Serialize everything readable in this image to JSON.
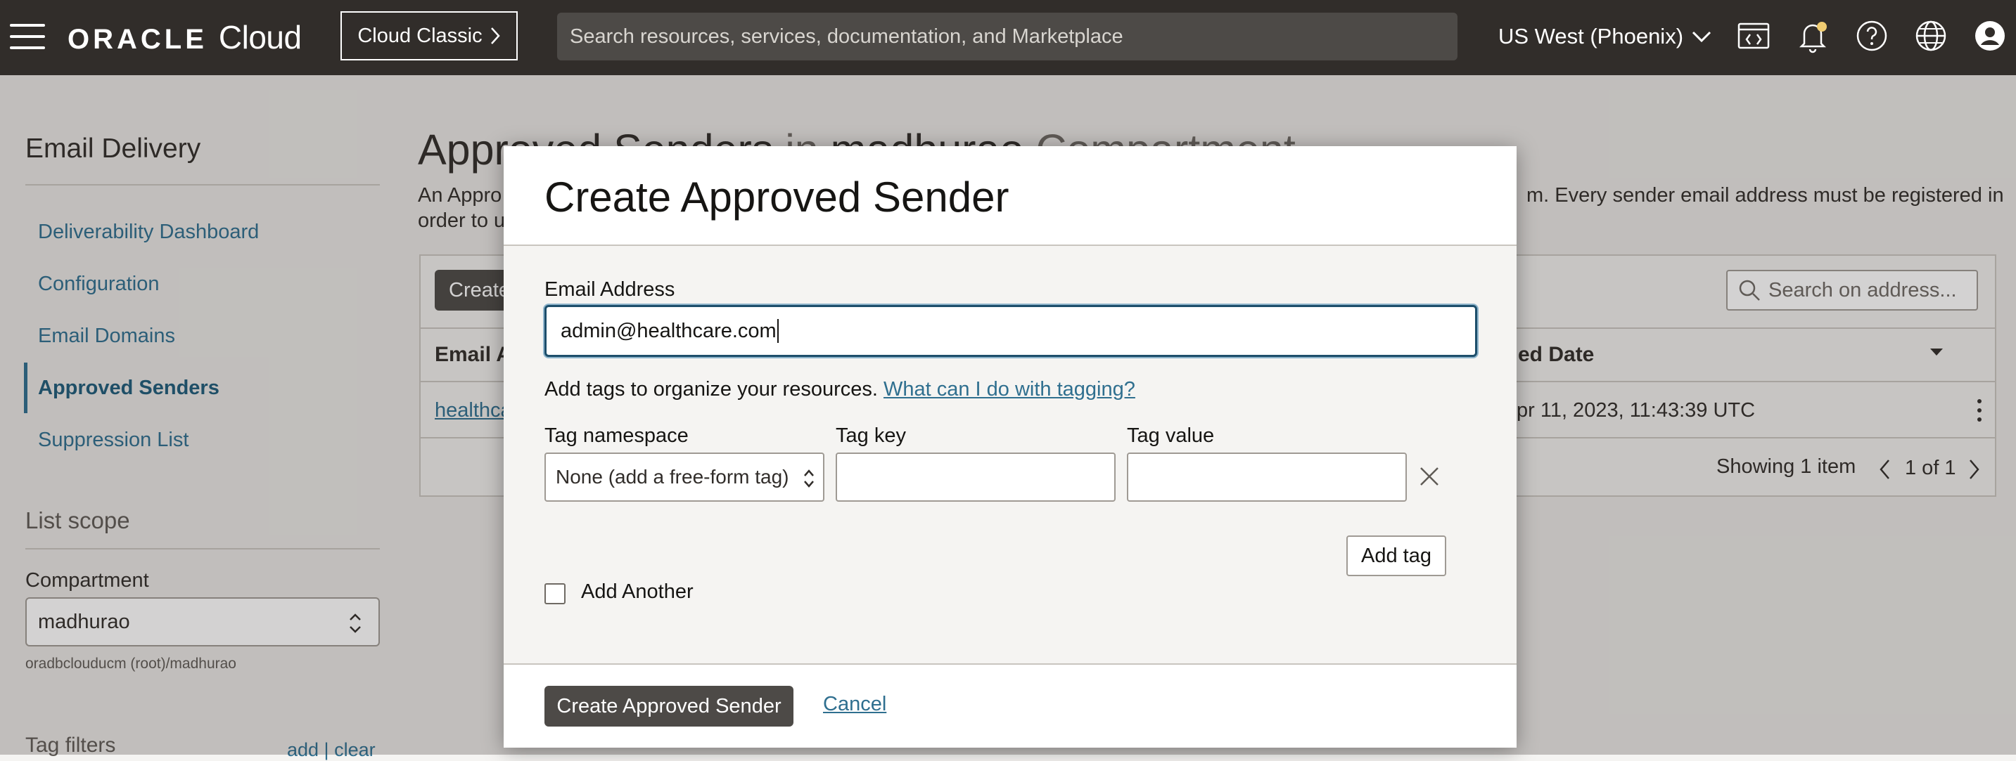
{
  "topbar": {
    "logo_brand": "ORACLE",
    "logo_product": "Cloud",
    "classic_label": "Cloud Classic",
    "search_placeholder": "Search resources, services, documentation, and Marketplace",
    "region": "US West (Phoenix)",
    "icons": [
      "menu-icon",
      "cloud-shell-icon",
      "bell-icon",
      "help-icon",
      "globe-icon",
      "profile-icon"
    ],
    "notification_dot_color": "#f0cc71"
  },
  "sidebar": {
    "title": "Email Delivery",
    "items": [
      {
        "label": "Deliverability Dashboard"
      },
      {
        "label": "Configuration"
      },
      {
        "label": "Email Domains"
      },
      {
        "label": "Approved Senders",
        "active": true
      },
      {
        "label": "Suppression List"
      }
    ],
    "scope_title": "List scope",
    "compartment_label": "Compartment",
    "compartment_value": "madhurao",
    "compartment_path": "oradbclouducm (root)/madhurao",
    "tag_filters_title": "Tag filters",
    "tag_filters_links": "add | clear"
  },
  "main": {
    "title_part1": "Approved Senders",
    "title_in": "in",
    "title_compartment": "madhurao",
    "title_suffix": "Compartment",
    "description_start": "An Appro",
    "description_line2_start": "order to u",
    "description_end": "m. Every sender email address must be registered in",
    "create_button_partial": "Create",
    "search_placeholder": "Search on address...",
    "column_email_partial": "Email A",
    "column_date_partial": "ed Date",
    "row_email_partial": "healthca",
    "row_date_partial": "pr 11, 2023, 11:43:39 UTC",
    "showing": "Showing 1 item",
    "pagination": "1 of 1"
  },
  "dialog": {
    "title": "Create Approved Sender",
    "email_label": "Email Address",
    "email_value": "admin@healthcare.com",
    "tags_text": "Add tags to organize your resources.",
    "tags_link": "What can I do with tagging?",
    "tag_namespace_label": "Tag namespace",
    "tag_namespace_value": "None (add a free-form tag)",
    "tag_key_label": "Tag key",
    "tag_key_value": "",
    "tag_value_label": "Tag value",
    "tag_value_value": "",
    "add_tag_label": "Add tag",
    "add_another_label": "Add Another",
    "add_another_checked": false,
    "create_label": "Create Approved Sender",
    "cancel_label": "Cancel"
  },
  "colors": {
    "topbar": "#312d2a",
    "link": "#2f6f8f",
    "primary_button": "#4d4a47",
    "focus_border": "#1d4e6b"
  }
}
